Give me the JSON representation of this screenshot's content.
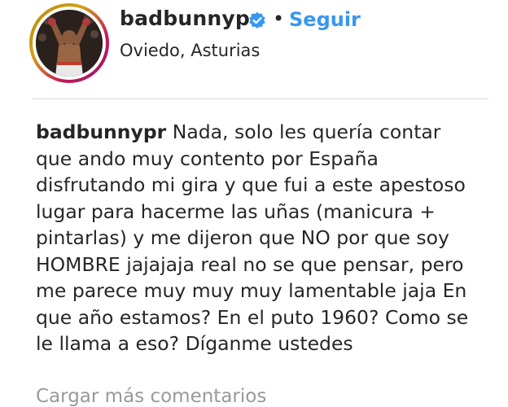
{
  "post": {
    "username": "badbunnypr",
    "verified_icon": "verified-badge-icon",
    "separator": "•",
    "follow_label": "Seguir",
    "location": "Oviedo, Asturias",
    "caption_lines": [
      "Nada, solo les quería contar",
      "que ando muy contento por España",
      "disfrutando mi gira y que fui a este apestoso",
      "lugar para hacerme las uñas (manicura +",
      "pintarlas) y me dijeron que NO por que soy",
      "HOMBRE jajajaja real no se que pensar, pero",
      "me parece muy muy muy lamentable jaja En",
      "que año estamos? En el puto 1960? Como se",
      "le llama a eso? Díganme ustedes"
    ],
    "load_more_label": "Cargar más comentarios"
  },
  "colors": {
    "text": "#262626",
    "link_blue": "#3897f0",
    "verified_blue": "#3897f0",
    "muted": "#999999",
    "divider": "#dbdbdb"
  }
}
